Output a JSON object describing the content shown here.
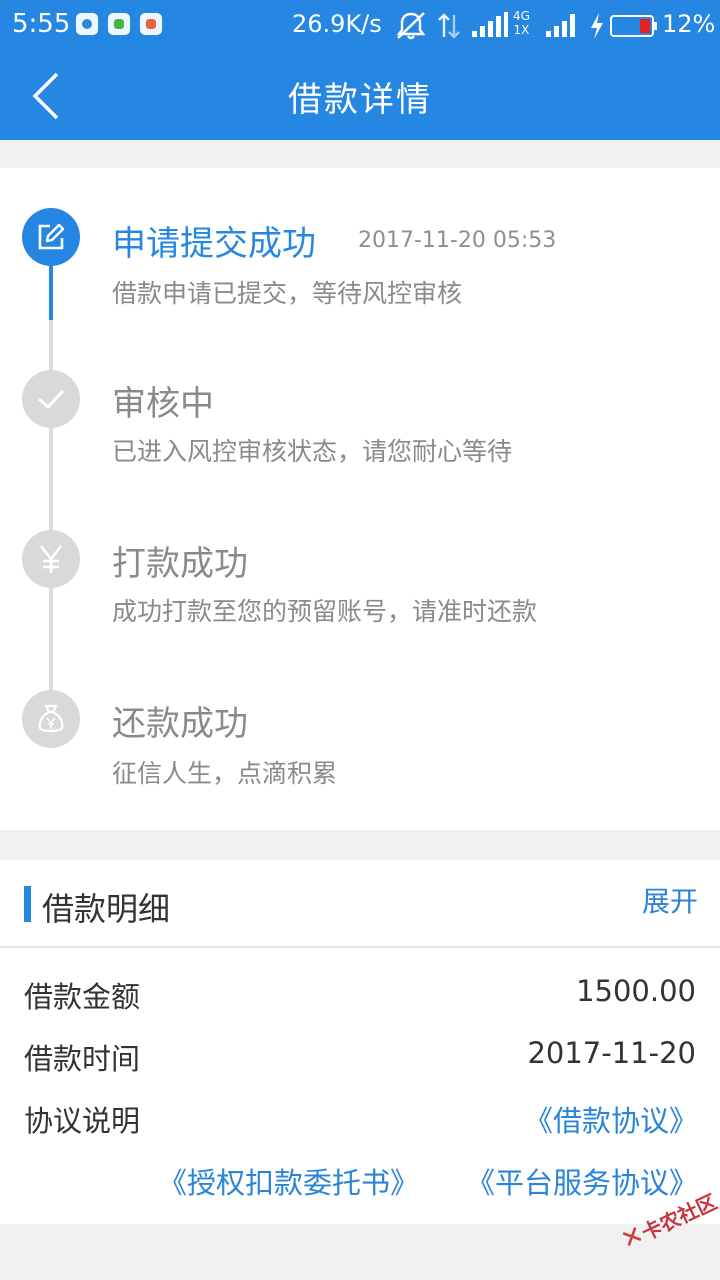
{
  "status_bar": {
    "time": "5:55",
    "net_speed": "26.9K/s",
    "network_label_top": "4G",
    "network_label_bottom": "1X",
    "battery_percent": "12%"
  },
  "header": {
    "title": "借款详情"
  },
  "timeline": {
    "steps": [
      {
        "title": "申请提交成功",
        "time": "2017-11-20 05:53",
        "desc": "借款申请已提交，等待风控审核",
        "icon": "edit-icon",
        "active": true
      },
      {
        "title": "审核中",
        "time": "",
        "desc": "已进入风控审核状态，请您耐心等待",
        "icon": "check-icon",
        "active": false
      },
      {
        "title": "打款成功",
        "time": "",
        "desc": "成功打款至您的预留账号，请准时还款",
        "icon": "yen-icon",
        "active": false
      },
      {
        "title": "还款成功",
        "time": "",
        "desc": "征信人生，点滴积累",
        "icon": "money-bag-icon",
        "active": false
      }
    ]
  },
  "details": {
    "title": "借款明细",
    "expand_label": "展开",
    "rows": [
      {
        "label": "借款金额",
        "value": "1500.00"
      },
      {
        "label": "借款时间",
        "value": "2017-11-20"
      }
    ],
    "agreement_label": "协议说明",
    "agreements": [
      "《借款协议》",
      "《授权扣款委托书》",
      "《平台服务协议》"
    ]
  },
  "watermark": "卡农社区",
  "colors": {
    "accent": "#2687e3",
    "inactive": "#d9d9d9",
    "link": "#2a84d8"
  }
}
